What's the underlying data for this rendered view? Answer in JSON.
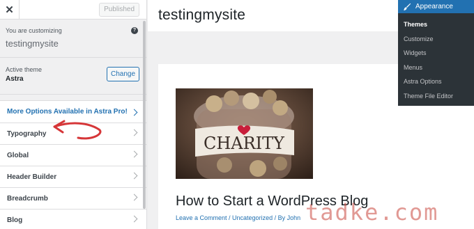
{
  "sidebar": {
    "close_icon": "close-icon",
    "published_label": "Published",
    "customizing_label": "You are customizing",
    "site_name": "testingmysite",
    "help_icon_glyph": "?",
    "active_theme_label": "Active theme",
    "theme_name": "Astra",
    "change_label": "Change",
    "pro_label": "More Options Available in Astra Pro!",
    "items": [
      {
        "label": "Typography"
      },
      {
        "label": "Global"
      },
      {
        "label": "Header Builder"
      },
      {
        "label": "Breadcrumb"
      },
      {
        "label": "Blog"
      }
    ]
  },
  "preview": {
    "site_title": "testingmysite",
    "post_title": "How to Start a WordPress Blog",
    "post_meta": "Leave a Comment / Uncategorized / By John",
    "image_text": "CHARITY"
  },
  "admin_menu": {
    "header": "Appearance",
    "header_icon": "paintbrush-icon",
    "items": [
      {
        "label": "Themes"
      },
      {
        "label": "Customize"
      },
      {
        "label": "Widgets"
      },
      {
        "label": "Menus"
      },
      {
        "label": "Astra Options"
      },
      {
        "label": "Theme File Editor"
      }
    ]
  },
  "watermark": "tadke.com",
  "colors": {
    "accent": "#2271b1",
    "admin_bg": "#2c3338",
    "annotation": "#d63638"
  }
}
